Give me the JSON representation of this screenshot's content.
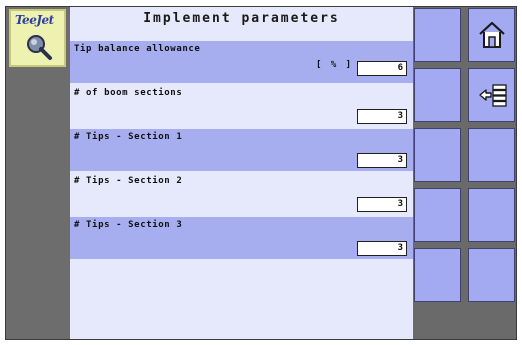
{
  "brand": {
    "logo_text": "TeeJet"
  },
  "title": "Implement parameters",
  "params": [
    {
      "label": "Tip balance allowance",
      "unit": "[ % ]",
      "value": "6"
    },
    {
      "label": "# of boom sections",
      "value": "3"
    },
    {
      "label": "# Tips - Section 1",
      "value": "3"
    },
    {
      "label": "# Tips - Section 2",
      "value": "3"
    },
    {
      "label": "# Tips - Section 3",
      "value": "3"
    }
  ],
  "side_buttons": [
    {
      "icon": "none"
    },
    {
      "icon": "home-icon"
    },
    {
      "icon": "none"
    },
    {
      "icon": "exit-list-icon"
    },
    {
      "icon": "none"
    },
    {
      "icon": "none"
    },
    {
      "icon": "none"
    },
    {
      "icon": "none"
    },
    {
      "icon": "none"
    },
    {
      "icon": "none"
    }
  ],
  "colors": {
    "panel_background": "#e6e8fb",
    "row_highlight": "#a7aef0",
    "button_fill": "#a4aaf2",
    "frame_gray": "#6a6a6a"
  }
}
